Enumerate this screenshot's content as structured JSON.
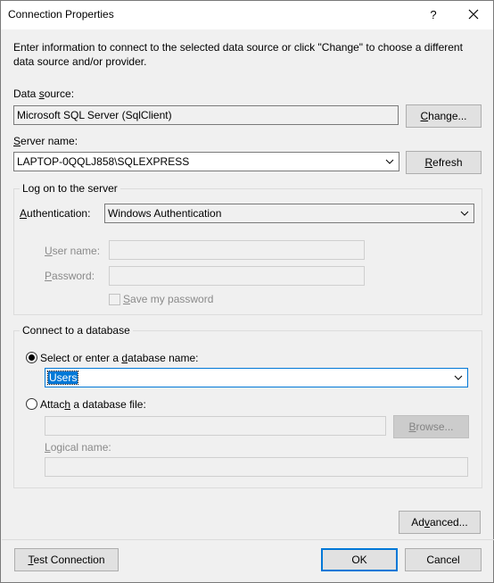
{
  "window": {
    "title": "Connection Properties",
    "help_glyph": "?",
    "intro_line1": "Enter information to connect to the selected data source or click \"Change\" to choose a different",
    "intro_line2": "data source and/or provider."
  },
  "data_source": {
    "label_pre": "Data ",
    "label_u": "s",
    "label_post": "ource:",
    "value": "Microsoft SQL Server (SqlClient)",
    "change_u": "C",
    "change_post": "hange..."
  },
  "server_name": {
    "label_u": "S",
    "label_post": "erver name:",
    "value": "LAPTOP-0QQLJ858\\SQLEXPRESS",
    "refresh_u": "R",
    "refresh_post": "efresh"
  },
  "logon": {
    "group_title": "Log on to the server",
    "auth_label_u": "A",
    "auth_label_post": "uthentication:",
    "auth_value": "Windows Authentication",
    "user_label_u": "U",
    "user_label_post": "ser name:",
    "user_value": "",
    "password_label_u": "P",
    "password_label_post": "assword:",
    "password_value": "",
    "save_label_u": "S",
    "save_label_post": "ave my password",
    "save_checked": false
  },
  "database": {
    "group_title": "Connect to a database",
    "select_label_pre": "Select or enter a ",
    "select_label_u": "d",
    "select_label_post": "atabase name:",
    "select_checked": true,
    "db_name": "Users",
    "attach_label_pre": "Attac",
    "attach_label_u": "h",
    "attach_label_post": " a database file:",
    "attach_checked": false,
    "attach_value": "",
    "browse_u": "B",
    "browse_post": "rowse...",
    "logical_label_u": "L",
    "logical_label_post": "ogical name:",
    "logical_value": ""
  },
  "footer": {
    "advanced_pre": "Ad",
    "advanced_u": "v",
    "advanced_post": "anced...",
    "test_u": "T",
    "test_post": "est Connection",
    "ok_label": "OK",
    "cancel_label": "Cancel"
  },
  "icons": {
    "close": "close-icon",
    "chevron": "chevron-down-icon"
  }
}
